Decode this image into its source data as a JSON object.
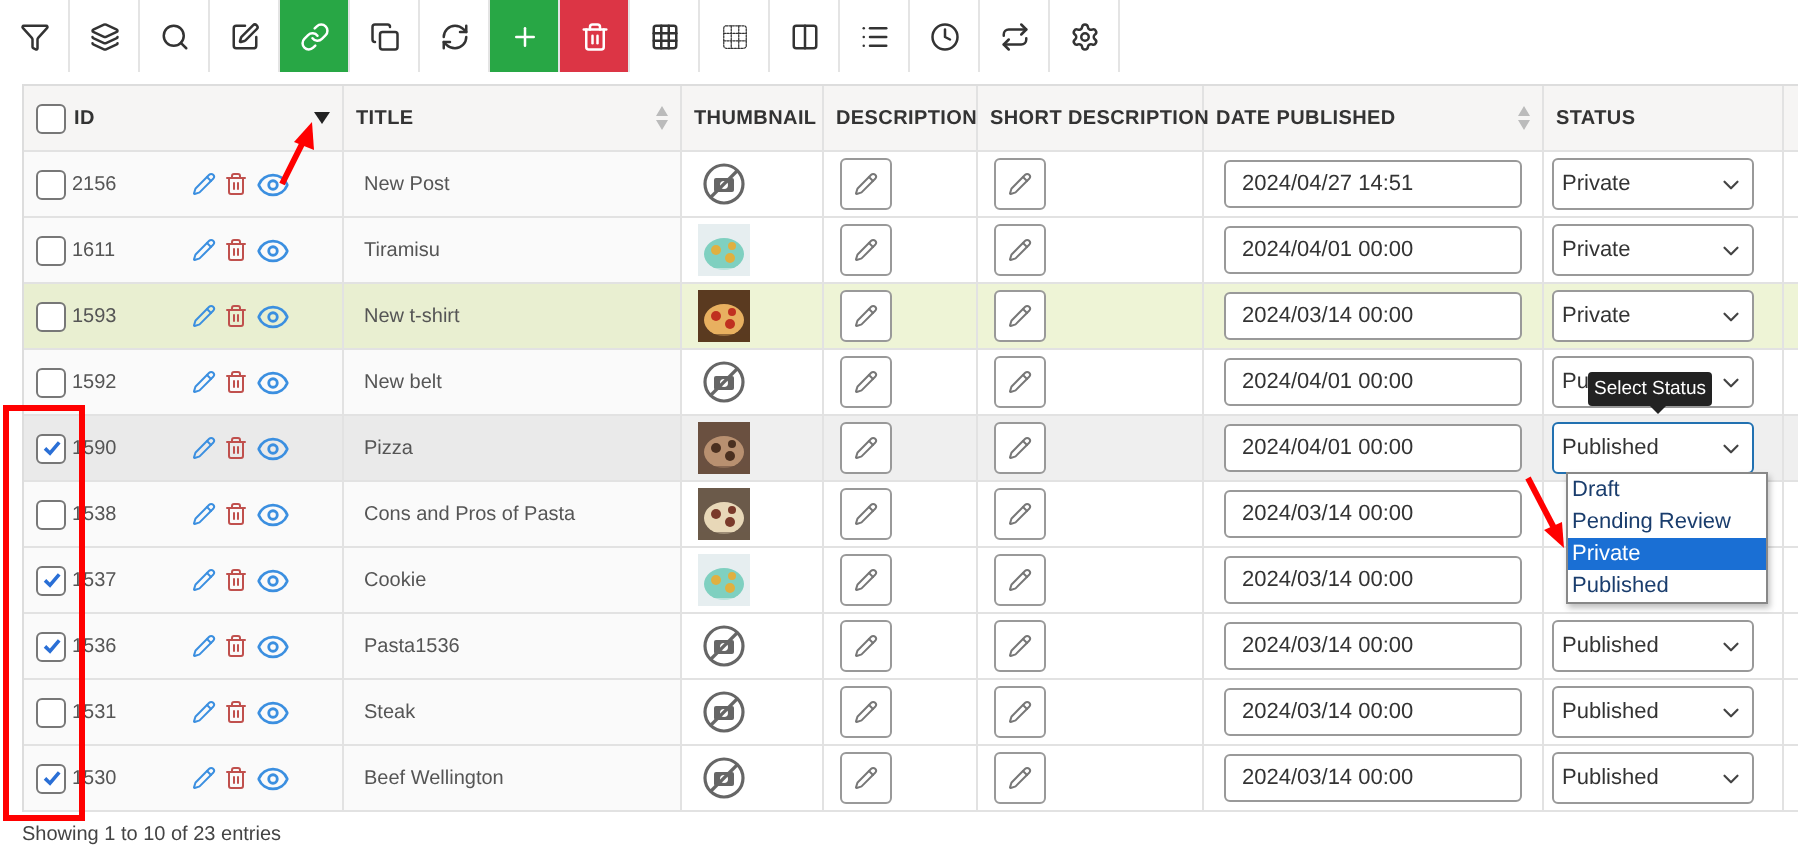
{
  "toolbar": [
    {
      "kind": "plain"
    },
    {
      "kind": "plain"
    },
    {
      "kind": "plain"
    },
    {
      "kind": "plain"
    },
    {
      "kind": "success"
    },
    {
      "kind": "plain"
    },
    {
      "kind": "plain"
    },
    {
      "kind": "success"
    },
    {
      "kind": "danger"
    },
    {
      "kind": "plain"
    },
    {
      "kind": "plain"
    },
    {
      "kind": "plain"
    },
    {
      "kind": "plain"
    },
    {
      "kind": "plain"
    },
    {
      "kind": "plain"
    },
    {
      "kind": "plain"
    }
  ],
  "table": {
    "select_all": {
      "checked": false
    },
    "columns": [
      {
        "label": "ID",
        "sorted": true
      },
      {
        "label": "TITLE",
        "sorted": false
      },
      {
        "label": "THUMBNAIL"
      },
      {
        "label": "DESCRIPTION"
      },
      {
        "label": "SHORT DESCRIPTION"
      },
      {
        "label": "DATE PUBLISHED",
        "sorted": false
      },
      {
        "label": "STATUS"
      }
    ],
    "rows": [
      {
        "id": "2156",
        "title": "New Post",
        "checked": false,
        "highlighted": false,
        "hovered": false,
        "thumbnail": {
          "kind": "none"
        },
        "date": "2024/04/27 14:51",
        "status": "Private"
      },
      {
        "id": "1611",
        "title": "Tiramisu",
        "checked": false,
        "highlighted": false,
        "hovered": false,
        "date": "2024/04/01 00:00",
        "status": "Private"
      },
      {
        "id": "1593",
        "title": "New t-shirt",
        "checked": false,
        "highlighted": true,
        "hovered": false,
        "date": "2024/03/14 00:00",
        "status": "Private"
      },
      {
        "id": "1592",
        "title": "New belt",
        "checked": false,
        "highlighted": false,
        "hovered": false,
        "thumbnail": {
          "kind": "none"
        },
        "date": "2024/04/01 00:00",
        "status": "Pu"
      },
      {
        "id": "1590",
        "title": "Pizza",
        "checked": true,
        "highlighted": false,
        "hovered": true,
        "date": "2024/04/01 00:00",
        "status": "Published",
        "status_menu": {
          "tooltip": "Select Status",
          "options": [
            {
              "label": "Draft",
              "selected": false
            },
            {
              "label": "Pending Review",
              "selected": false
            },
            {
              "label": "Private",
              "selected": true
            },
            {
              "label": "Published",
              "selected": false
            }
          ]
        }
      },
      {
        "id": "1538",
        "title": "Cons and Pros of Pasta",
        "checked": false,
        "highlighted": false,
        "hovered": false,
        "date": "2024/03/14 00:00"
      },
      {
        "id": "1537",
        "title": "Cookie",
        "checked": true,
        "highlighted": false,
        "hovered": false,
        "date": "2024/03/14 00:00"
      },
      {
        "id": "1536",
        "title": "Pasta1536",
        "checked": true,
        "highlighted": false,
        "hovered": false,
        "thumbnail": {
          "kind": "none"
        },
        "date": "2024/03/14 00:00",
        "status": "Published"
      },
      {
        "id": "1531",
        "title": "Steak",
        "checked": false,
        "highlighted": false,
        "hovered": false,
        "thumbnail": {
          "kind": "none"
        },
        "date": "2024/03/14 00:00",
        "status": "Published"
      },
      {
        "id": "1530",
        "title": "Beef Wellington",
        "checked": true,
        "highlighted": false,
        "hovered": false,
        "thumbnail": {
          "kind": "none"
        },
        "date": "2024/03/14 00:00",
        "status": "Published"
      }
    ]
  },
  "footer": {
    "text": "Showing 1 to 10 of 23 entries"
  }
}
